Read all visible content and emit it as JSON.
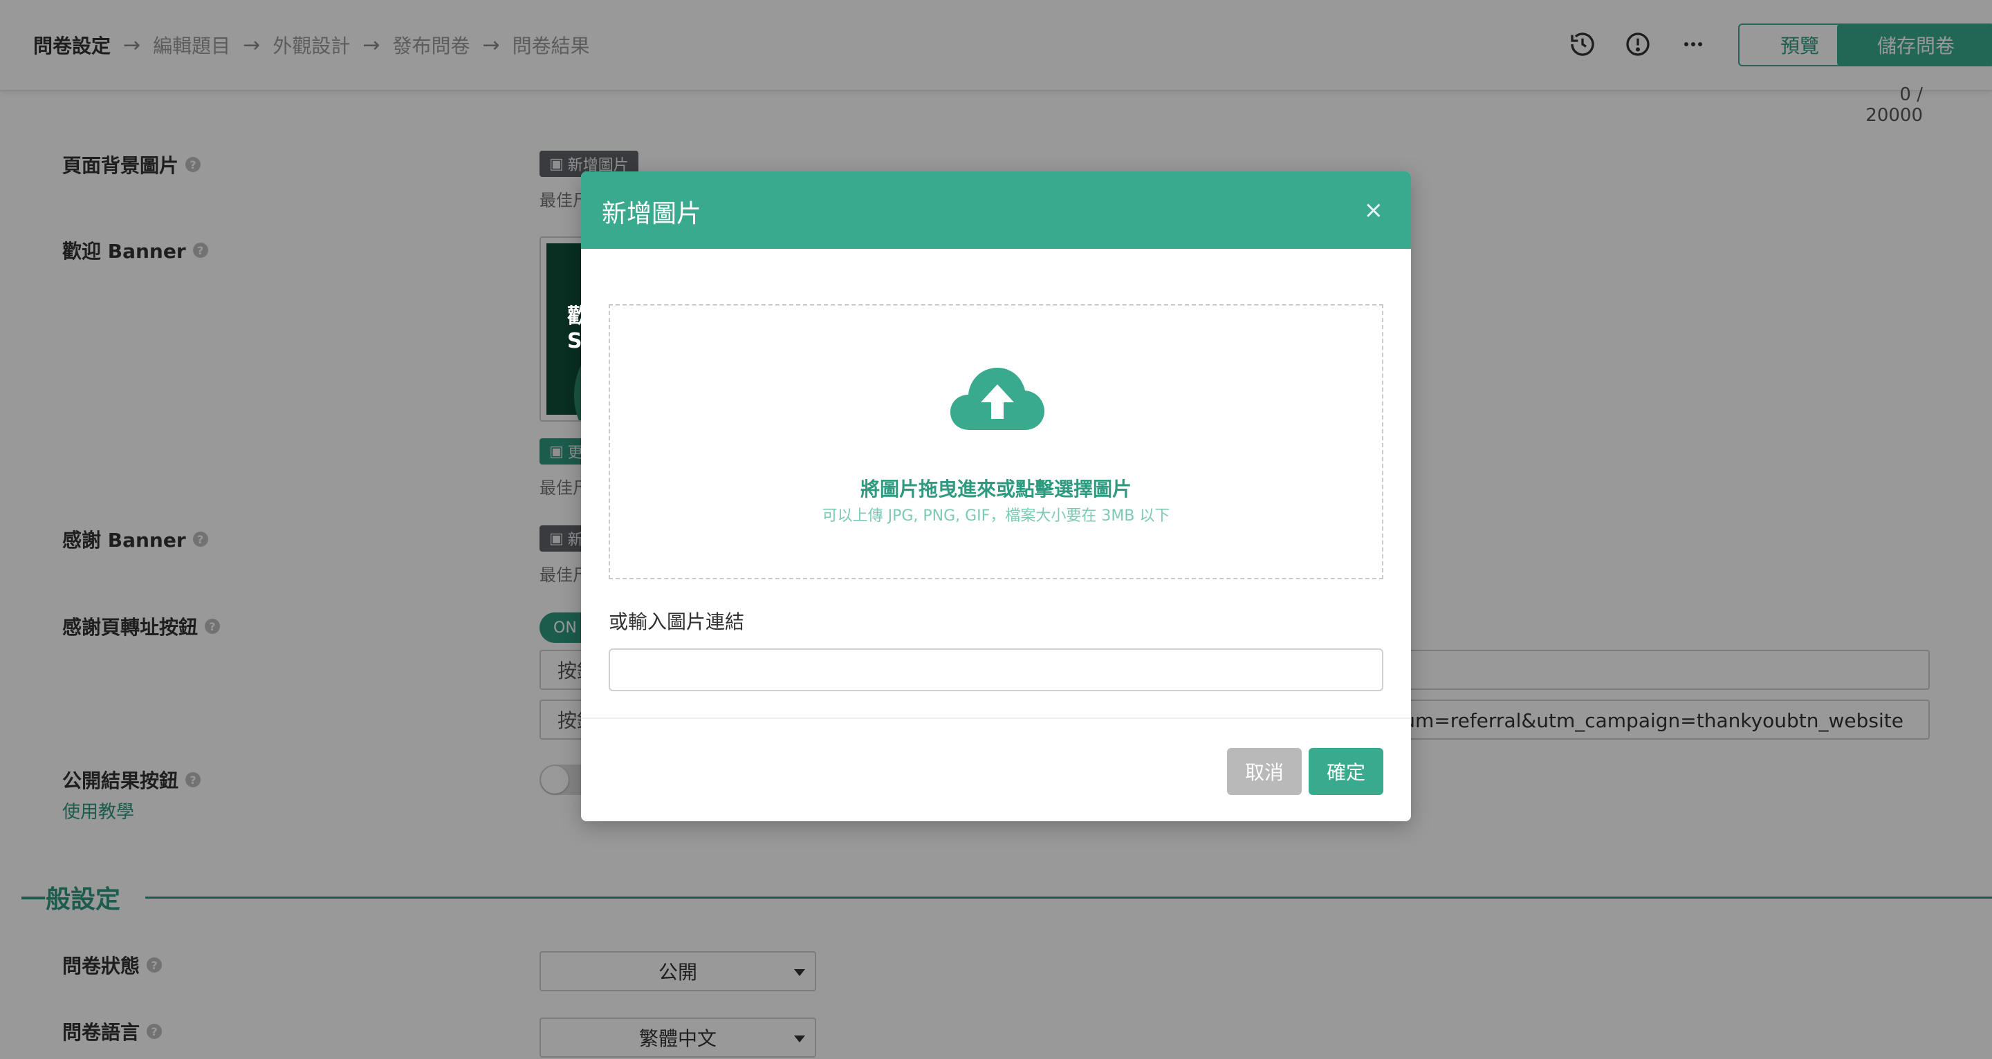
{
  "topbar": {
    "breadcrumbs": [
      "問卷設定",
      "編輯題目",
      "外觀設計",
      "發布問卷",
      "問卷結果"
    ],
    "arrow": "→",
    "icons": [
      "history-icon",
      "info-icon",
      "more-icon"
    ],
    "preview_label": "預覽",
    "save_label": "儲存問卷"
  },
  "form": {
    "counter": "0 / 20000",
    "help_glyph": "?",
    "bg_image": {
      "label": "頁面背景圖片",
      "button": "新增圖片",
      "hint": "最佳尺寸"
    },
    "welcome_banner": {
      "label": "歡迎 Banner",
      "thumb_text": "歡\nS",
      "button": "更換圖片",
      "hint": "最佳尺寸"
    },
    "thanks_banner": {
      "label": "感謝 Banner",
      "button": "新增圖片",
      "hint": "最佳尺寸"
    },
    "redirect_button": {
      "label": "感謝頁轉址按鈕",
      "toggle": "ON",
      "field1": "按鈕",
      "field2": "按鈕",
      "field2_tail": "n_medium=referral&utm_campaign=thankyoubtn_website"
    },
    "public_result": {
      "label": "公開結果按鈕",
      "link": "使用教學"
    },
    "general_section": "一般設定",
    "status": {
      "label": "問卷狀態",
      "value": "公開"
    },
    "language": {
      "label": "問卷語言",
      "value": "繁體中文"
    }
  },
  "modal": {
    "title": "新增圖片",
    "close": "×",
    "drop_main": "將圖片拖曳進來或點擊選擇圖片",
    "drop_sub": "可以上傳 JPG, PNG, GIF，檔案大小要在 3MB 以下",
    "url_label": "或輸入圖片連結",
    "url_value": "",
    "cancel_label": "取消",
    "ok_label": "確定"
  },
  "colors": {
    "accent": "#3aaa8f",
    "accent_dark": "#2e9a80",
    "overlay": "rgba(0,0,0,0.4)"
  }
}
